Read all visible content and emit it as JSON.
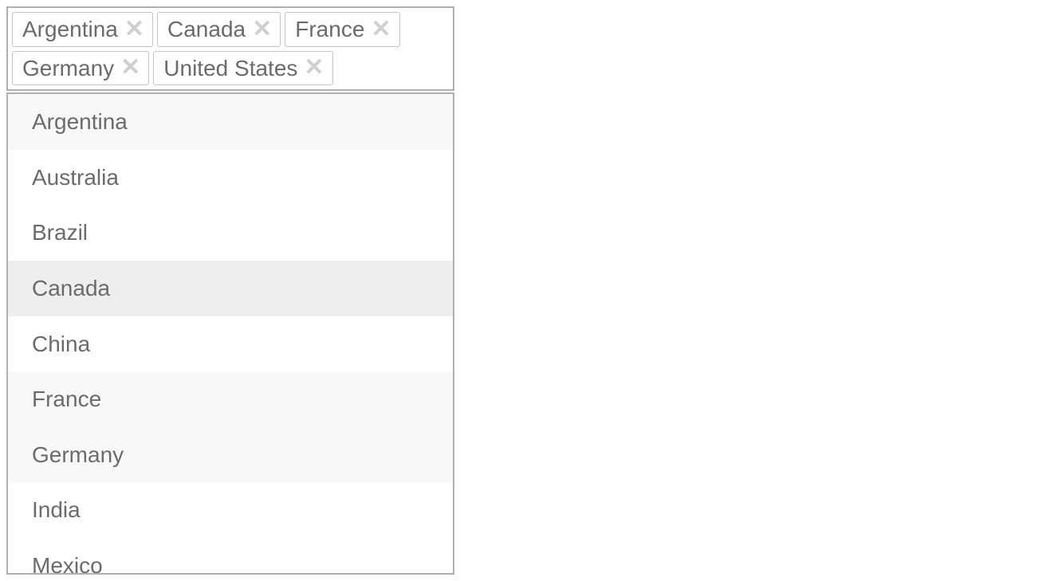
{
  "multiselect": {
    "selected": [
      {
        "label": "Argentina"
      },
      {
        "label": "Canada"
      },
      {
        "label": "France"
      },
      {
        "label": "Germany"
      },
      {
        "label": "United States"
      }
    ],
    "options": [
      {
        "label": "Argentina",
        "state": "selected"
      },
      {
        "label": "Australia",
        "state": "normal"
      },
      {
        "label": "Brazil",
        "state": "normal"
      },
      {
        "label": "Canada",
        "state": "highlight"
      },
      {
        "label": "China",
        "state": "normal"
      },
      {
        "label": "France",
        "state": "selected"
      },
      {
        "label": "Germany",
        "state": "selected"
      },
      {
        "label": "India",
        "state": "normal"
      },
      {
        "label": "Mexico",
        "state": "normal"
      }
    ],
    "remove_glyph": "✕"
  }
}
